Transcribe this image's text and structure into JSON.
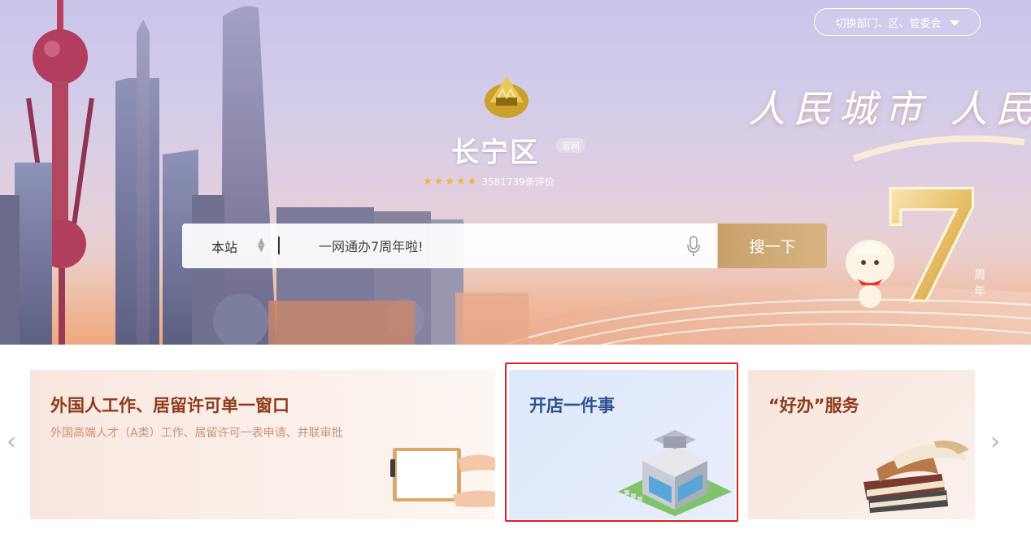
{
  "header": {
    "switch_label": "切换部门、区、管委会"
  },
  "hero": {
    "district_name": "长宁区",
    "official_tag": "官网",
    "rating_stars": 5,
    "rating_count": "3581739条评价",
    "slogan": "人民城市 人民",
    "anniversary": {
      "number": "7",
      "suffix": "周年"
    }
  },
  "search": {
    "scope_label": "本站",
    "placeholder": "一网通办7周年啦!",
    "button_label": "搜一下"
  },
  "cards": [
    {
      "title": "外国人工作、居留许可单一窗口",
      "description": "外国高端人才（A类）工作、居留许可一表申请、并联审批"
    },
    {
      "title": "开店一件事",
      "description": ""
    },
    {
      "title": "“好办”服务",
      "description": ""
    }
  ],
  "carousel": {
    "prev_label": "‹",
    "next_label": "›"
  },
  "colors": {
    "accent_gold": "#c8a06a",
    "card_title_red": "#8f3a1b",
    "card_title_blue": "#2c4f8e",
    "highlight_red": "#e0201e"
  }
}
